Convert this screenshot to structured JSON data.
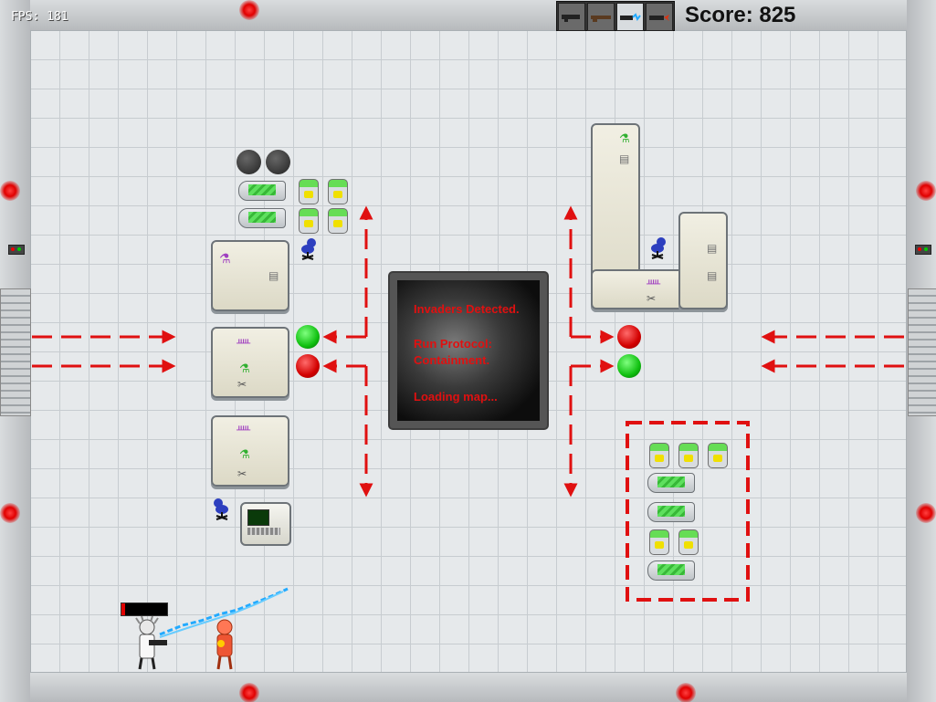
{
  "hud": {
    "fps_text": "FPS: 181",
    "score_text": "Score: 825",
    "health_fraction": 0.08
  },
  "weapons": [
    {
      "icon": "blaster-icon",
      "active": false
    },
    {
      "icon": "rifle-icon",
      "active": false
    },
    {
      "icon": "lightning-gun-icon",
      "active": true
    },
    {
      "icon": "flamethrower-icon",
      "active": false
    }
  ],
  "screen": {
    "line1": "Invaders Detected.",
    "line2": "Run Protocol:",
    "line3": "Containment.",
    "line4": "Loading map..."
  },
  "colors": {
    "arrow": "#e01010",
    "light_red": "#e00000",
    "light_green": "#10c010",
    "laser": "#22aaff"
  }
}
